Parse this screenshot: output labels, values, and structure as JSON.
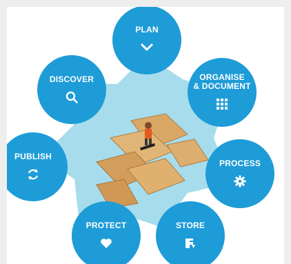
{
  "diagram": {
    "nodes": [
      {
        "id": "plan",
        "label": "PLAN",
        "icon": "chevron-down-icon"
      },
      {
        "id": "organise",
        "label": "ORGANISE\n& DOCUMENT",
        "icon": "grid-icon"
      },
      {
        "id": "process",
        "label": "PROCESS",
        "icon": "gear-icon"
      },
      {
        "id": "store",
        "label": "STORE",
        "icon": "storage-icon"
      },
      {
        "id": "protect",
        "label": "PROTECT",
        "icon": "heart-icon"
      },
      {
        "id": "publish",
        "label": "PUBLISH",
        "icon": "refresh-icon"
      },
      {
        "id": "discover",
        "label": "DISCOVER",
        "icon": "search-icon"
      }
    ],
    "colors": {
      "node": "#1e9cd7",
      "center": "#a6dcec",
      "background": "#eeeeee",
      "panel": "#ffffff"
    }
  }
}
